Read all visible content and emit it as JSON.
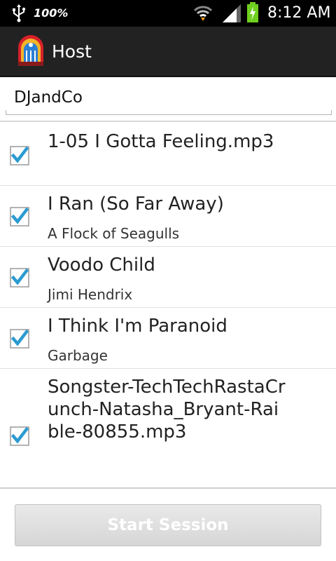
{
  "status_bar": {
    "battery_percent": "100%",
    "time": "8:12 AM"
  },
  "action_bar": {
    "title": "Host",
    "icon": "jukebox-icon"
  },
  "session_name": {
    "value": "DJandCo"
  },
  "songs": [
    {
      "title": "1-05 I Gotta Feeling.mp3",
      "artist": "",
      "checked": true
    },
    {
      "title": "I Ran (So Far Away)",
      "artist": "A Flock of Seagulls",
      "checked": true
    },
    {
      "title": "Voodo Child",
      "artist": "Jimi Hendrix",
      "checked": true
    },
    {
      "title": "I Think I'm Paranoid",
      "artist": "Garbage",
      "checked": true
    },
    {
      "title": "Songster-TechTechRastaCrunch-Natasha_Bryant-Raible-80855.mp3",
      "artist": "",
      "checked": true
    }
  ],
  "start_button": {
    "label": "Start Session",
    "enabled": false
  },
  "colors": {
    "check_accent": "#2b9bd1",
    "action_bar": "#222222",
    "status_bar": "#000000"
  }
}
